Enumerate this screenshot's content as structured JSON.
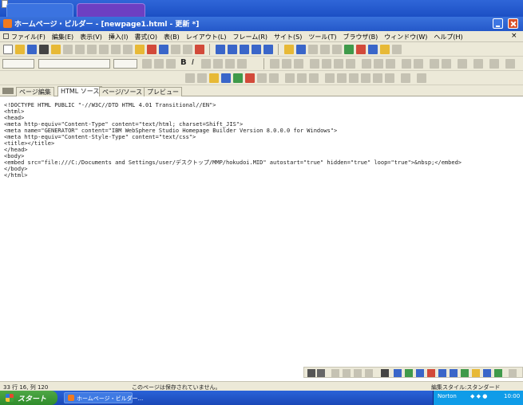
{
  "window": {
    "title": "ホームページ・ビルダー - [newpage1.html - 更新 *]"
  },
  "menubar": {
    "items": [
      "ファイル(F)",
      "編集(E)",
      "表示(V)",
      "挿入(I)",
      "書式(O)",
      "表(B)",
      "レイアウト(L)",
      "フレーム(R)",
      "サイト(S)",
      "ツール(T)",
      "ブラウザ(B)",
      "ウィンドウ(W)",
      "ヘルプ(H)"
    ]
  },
  "tabs": [
    {
      "label": "ページ編集"
    },
    {
      "label": "HTML ソース"
    },
    {
      "label": "ページ/ソース"
    },
    {
      "label": "プレビュー"
    }
  ],
  "editor": {
    "lines": [
      "<!DOCTYPE HTML PUBLIC \"-//W3C//DTD HTML 4.01 Transitional//EN\">",
      "<html>",
      "<head>",
      "<meta http-equiv=\"Content-Type\" content=\"text/html; charset=Shift_JIS\">",
      "<meta name=\"GENERATOR\" content=\"IBM WebSphere Studio Homepage Builder Version 8.0.0.0 for Windows\">",
      "<meta http-equiv=\"Content-Style-Type\" content=\"text/css\">",
      "<title></title>",
      "</head>",
      "<body>",
      "<embed src=\"file:///C:/Documents and Settings/user/デスクトップ/MMP/hokudoi.MID\" autostart=\"true\" hidden=\"true\" loop=\"true\">&nbsp;</embed>",
      "</body>",
      "</html>"
    ]
  },
  "statusbar": {
    "line_col": "33   行 16, 列 120",
    "message": "このページは保存されていません。",
    "style": "編集スタイル:スタンダード"
  },
  "taskbar": {
    "start_label": "スタート",
    "task_label": "ホームページ・ビルダー...",
    "tray_norton": "Norton",
    "tray_time": "10:00"
  },
  "colors": {
    "title_bar": "#2458c9",
    "chrome": "#ece9d8",
    "taskbar": "#1a48b7",
    "start_button": "#2f8c2b"
  }
}
